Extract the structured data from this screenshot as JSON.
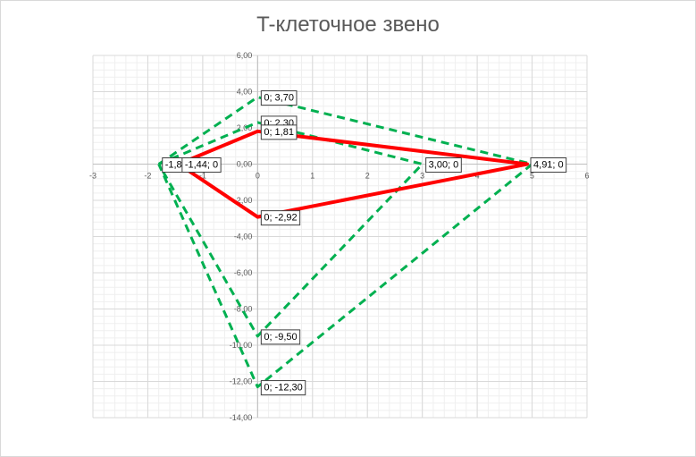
{
  "chart_data": {
    "type": "scatter",
    "title": "T-клеточное звено",
    "xlabel": "",
    "ylabel": "",
    "xlim": [
      -3,
      6
    ],
    "ylim": [
      -14,
      6
    ],
    "x_ticks": [
      -3,
      -2,
      -1,
      0,
      1,
      2,
      3,
      4,
      5,
      6
    ],
    "y_ticks": [
      -14,
      -12,
      -10,
      -8,
      -6,
      -4,
      -2,
      0,
      2,
      4,
      6
    ],
    "x_tick_labels": [
      "-3",
      "-2",
      "-1",
      "0",
      "1",
      "2",
      "3",
      "4",
      "5",
      "6"
    ],
    "y_tick_labels": [
      "-14,00",
      "-12,00",
      "-10,00",
      "-8,00",
      "-6,00",
      "-4,00",
      "-2,00",
      "0,00",
      "2,00",
      "4,00",
      "6,00"
    ],
    "grid": true,
    "minor_grid": true,
    "series": [
      {
        "style": "solid",
        "color": "#ff0000",
        "points": [
          [
            -1.44,
            0
          ],
          [
            0,
            1.81
          ],
          [
            4.91,
            0
          ],
          [
            0,
            -2.92
          ],
          [
            -1.44,
            0
          ]
        ]
      },
      {
        "style": "dashed",
        "color": "#00b050",
        "points": [
          [
            -1.8,
            0
          ],
          [
            0,
            3.7
          ],
          [
            5,
            0
          ],
          [
            0,
            -12.3
          ],
          [
            -1.8,
            0
          ]
        ]
      },
      {
        "style": "dashed",
        "color": "#00b050",
        "points": [
          [
            -1.8,
            0
          ],
          [
            0,
            2.3
          ],
          [
            3.0,
            0
          ],
          [
            0,
            -9.5
          ],
          [
            -1.8,
            0
          ]
        ]
      }
    ],
    "data_labels": [
      {
        "text": "0; 3,70",
        "x": 0,
        "y": 3.7
      },
      {
        "text": "0; 2,30",
        "x": 0,
        "y": 2.3
      },
      {
        "text": "0; 1,81",
        "x": 0,
        "y": 1.81
      },
      {
        "text": "-1,8",
        "x": -1.8,
        "y": 0
      },
      {
        "text": "-1,44; 0",
        "x": -1.44,
        "y": 0
      },
      {
        "text": "3,00; 0",
        "x": 3.0,
        "y": 0
      },
      {
        "text": "4,91; 0",
        "x": 4.91,
        "y": 0
      },
      {
        "text": "0; -2,92",
        "x": 0,
        "y": -2.92
      },
      {
        "text": "0; -9,50",
        "x": 0,
        "y": -9.5
      },
      {
        "text": "0; -12,30",
        "x": 0,
        "y": -12.3
      }
    ]
  }
}
